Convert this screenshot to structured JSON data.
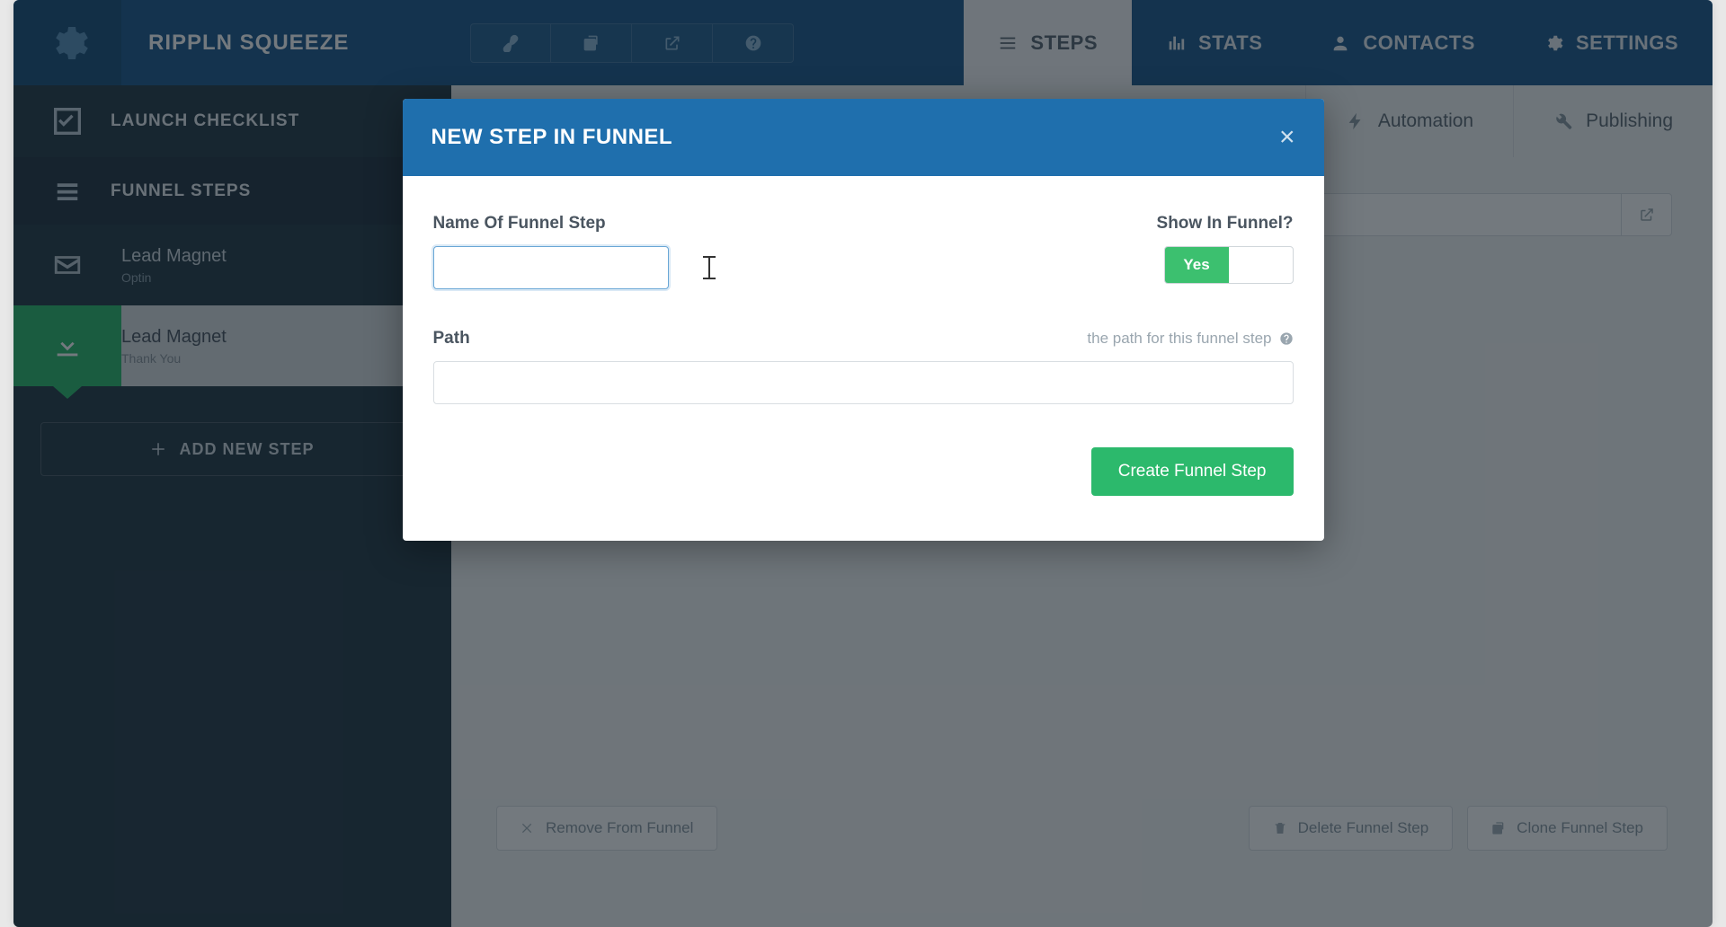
{
  "header": {
    "funnel_name": "RIPPLN SQUEEZE",
    "nav": {
      "steps": "STEPS",
      "stats": "STATS",
      "contacts": "CONTACTS",
      "settings": "SETTINGS"
    }
  },
  "sidebar": {
    "launch_checklist": "LAUNCH CHECKLIST",
    "funnel_steps": "FUNNEL STEPS",
    "steps": [
      {
        "title": "Lead Magnet",
        "sub": "Optin"
      },
      {
        "title": "Lead Magnet",
        "sub": "Thank You"
      }
    ],
    "add_new_step": "ADD NEW STEP"
  },
  "content_tabs": {
    "automation": "Automation",
    "publishing": "Publishing"
  },
  "footer": {
    "remove": "Remove From Funnel",
    "delete": "Delete Funnel Step",
    "clone": "Clone Funnel Step"
  },
  "modal": {
    "title": "NEW STEP IN FUNNEL",
    "name_label": "Name Of Funnel Step",
    "name_value": "",
    "show_in_funnel_label": "Show In Funnel?",
    "toggle_yes": "Yes",
    "path_label": "Path",
    "path_hint": "the path for this funnel step",
    "path_value": "",
    "create_btn": "Create Funnel Step"
  }
}
